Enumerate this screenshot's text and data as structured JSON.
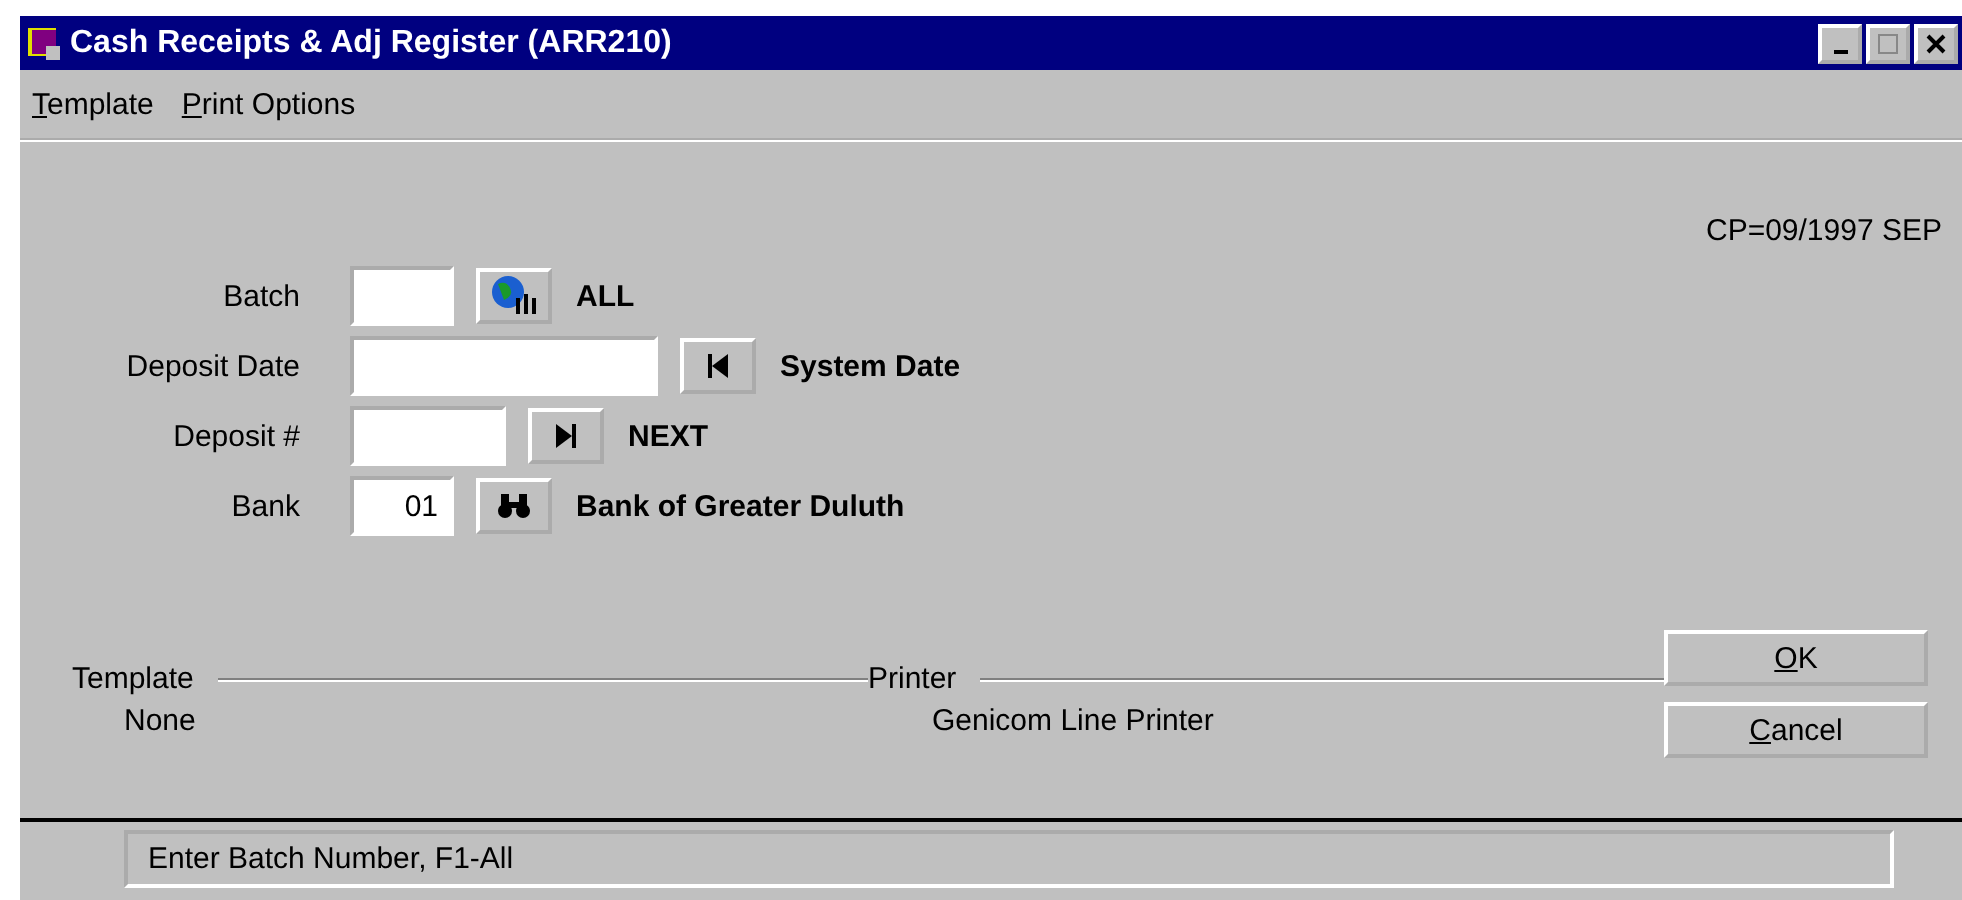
{
  "window": {
    "title": "Cash Receipts & Adj Register (ARR210)"
  },
  "menu": [
    {
      "underlined": "T",
      "rest": "emplate"
    },
    {
      "underlined": "P",
      "rest": "rint Options"
    }
  ],
  "period": "CP=09/1997 SEP",
  "fields": [
    {
      "label": "Batch",
      "kind": "all",
      "note": "ALL"
    },
    {
      "label": "Deposit Date",
      "kind": "first",
      "note": "System Date"
    },
    {
      "label": "Deposit #",
      "kind": "last",
      "note": "NEXT"
    },
    {
      "label": "Bank",
      "value": "01",
      "kind": "lookup",
      "note": "Bank of Greater Duluth"
    }
  ],
  "groups": [
    {
      "label": "Template",
      "value": "None"
    },
    {
      "label": "Printer",
      "value": "Genicom Line Printer"
    }
  ],
  "buttons": [
    {
      "underlined": "O",
      "rest": "K"
    },
    {
      "underlined": "C",
      "rest": "ancel"
    }
  ],
  "status_bar": "Enter Batch Number, F1-All"
}
